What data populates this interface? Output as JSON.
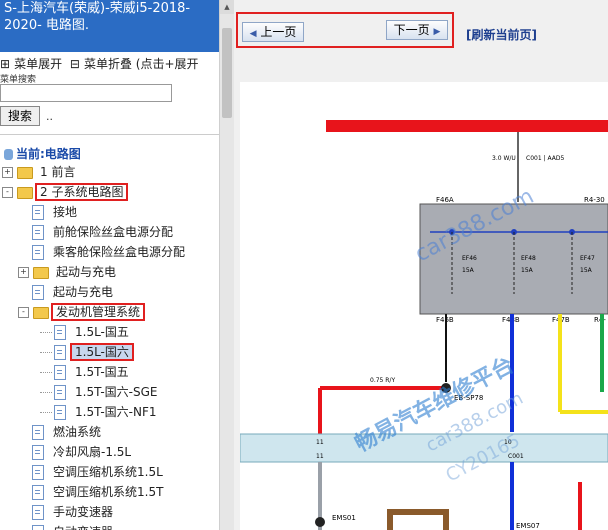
{
  "sidebar": {
    "title": "S-上海汽车(荣威)-荣威i5-2018-2020- 电路图.",
    "menu_expand": "菜单展开",
    "menu_collapse": "菜单折叠 (点击+展开",
    "search_label": "菜单搜索",
    "search_button": "搜索",
    "dots": "..",
    "current": "当前:电路图",
    "tree": [
      {
        "label": "1 前言",
        "level": 0,
        "kind": "folder",
        "toggle": "+"
      },
      {
        "label": "2 子系统电路图",
        "level": 0,
        "kind": "folder",
        "toggle": "-"
      },
      {
        "label": "接地",
        "level": 1,
        "kind": "doc"
      },
      {
        "label": "前舱保险丝盒电源分配",
        "level": 1,
        "kind": "doc"
      },
      {
        "label": "乘客舱保险丝盒电源分配",
        "level": 1,
        "kind": "doc"
      },
      {
        "label": "起动与充电",
        "level": 1,
        "kind": "folder",
        "toggle": "+"
      },
      {
        "label": "起动与充电",
        "level": 1,
        "kind": "doc"
      },
      {
        "label": "发动机管理系统",
        "level": 1,
        "kind": "folder",
        "toggle": "-"
      },
      {
        "label": "1.5L-国五",
        "level": 2,
        "kind": "doc"
      },
      {
        "label": "1.5L-国六",
        "level": 2,
        "kind": "doc"
      },
      {
        "label": "1.5T-国五",
        "level": 2,
        "kind": "doc"
      },
      {
        "label": "1.5T-国六-SGE",
        "level": 2,
        "kind": "doc"
      },
      {
        "label": "1.5T-国六-NF1",
        "level": 2,
        "kind": "doc"
      },
      {
        "label": "燃油系统",
        "level": 1,
        "kind": "doc"
      },
      {
        "label": "冷却风扇-1.5L",
        "level": 1,
        "kind": "doc"
      },
      {
        "label": "空调压缩机系统1.5L",
        "level": 1,
        "kind": "doc"
      },
      {
        "label": "空调压缩机系统1.5T",
        "level": 1,
        "kind": "doc"
      },
      {
        "label": "手动变速器",
        "level": 1,
        "kind": "doc"
      },
      {
        "label": "自动变速器",
        "level": 1,
        "kind": "doc"
      }
    ]
  },
  "toolbar": {
    "prev": "上一页",
    "next": "下一页",
    "refresh": "[刷新当前页]"
  },
  "diagram": {
    "wire_top_label": "3.0 W/U",
    "wire_top_conn": "C001 | AAD5",
    "box_left_top": "F46A",
    "box_right_top": "R4-30",
    "fuse1": "EF46",
    "fuse1_amp": "15A",
    "fuse2": "EF48",
    "fuse2_amp": "15A",
    "fuse3": "EF47",
    "fuse3_amp": "15A",
    "box_bottom_1": "F46B",
    "box_bottom_2": "F48B",
    "box_bottom_3": "F47B",
    "box_bottom_4": "R4-",
    "wire_ry": "0.75 R/Y",
    "splice": "EB-SP78",
    "conn_11a": "11",
    "conn_11b": "11",
    "conn_10": "10",
    "conn_c001": "C001",
    "ems01": "EMS01",
    "ems07": "EMS07",
    "wm1": "car388.com",
    "wm2": "畅易汽车维修平台",
    "wm3": "car388.com",
    "wm4": "CY20165",
    "colors": {
      "red": "#e8141b",
      "blue": "#1030d8",
      "green": "#1aa84a",
      "yellow": "#f4e21a",
      "brown": "#8a5a2b",
      "gray": "#9aa0a8",
      "box": "#a9acb3"
    }
  }
}
